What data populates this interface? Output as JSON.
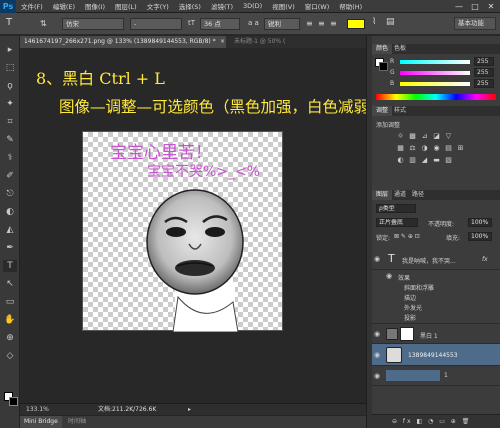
{
  "menu": {
    "logo": "Ps",
    "items": [
      "文件(F)",
      "编辑(E)",
      "图像(I)",
      "图层(L)",
      "文字(Y)",
      "选择(S)",
      "滤镜(T)",
      "3D(D)",
      "视图(V)",
      "窗口(W)",
      "帮助(H)"
    ],
    "window_controls": [
      "—",
      "□",
      "✕"
    ]
  },
  "options": {
    "tool_glyph": "T",
    "orient_glyph": "⇅",
    "font_family": "仿宋",
    "font_style": "-",
    "size_glyph": "tT",
    "font_size": "36 点",
    "aa_glyph": "a a",
    "anti_alias": "锐利",
    "align_icons": [
      "≡",
      "≡",
      "≡"
    ],
    "text_color": "#ffff00",
    "warp_glyph": "⌇",
    "panels_glyph": "▤",
    "workspace": "基本功能"
  },
  "document": {
    "tab1": "1461674197_266x271.png @ 133% (1389849144553, RGB/8) *",
    "tab1_close": "×",
    "tab2": "未标题-1 @ 50% (",
    "heading1": "8、黑白        Ctrl + L",
    "heading2": "图像—调整—可选颜色（黑色加强，白色减弱）",
    "meme_line1": "宝宝心里苦！",
    "meme_line2": "宝宝不哭%>_<%",
    "zoom": "133.1%",
    "doc_size": "文档:211.2K/726.6K",
    "status_arrow": "▸"
  },
  "minibridge": {
    "tab1": "Mini Bridge",
    "tab2": "时间轴"
  },
  "tools": [
    "▸",
    "⬚",
    "ϙ",
    "✦",
    "⌗",
    "✎",
    "⚕",
    "✐",
    "⎋",
    "◐",
    "◭",
    "✒",
    "T",
    "↖",
    "▭",
    "✋",
    "⊕",
    "◇"
  ],
  "panels": {
    "color_tabs": [
      "颜色",
      "色板"
    ],
    "color_values": [
      {
        "label": "R",
        "value": "255",
        "color": "#ff4d4d"
      },
      {
        "label": "G",
        "value": "255",
        "color": "#4dff4d"
      },
      {
        "label": "B",
        "value": "255",
        "color": "#4d7dff"
      }
    ],
    "adjust_tabs": [
      "调整",
      "样式"
    ],
    "adjust_title": "添加调整",
    "adjust_icons_row1": [
      "☼",
      "▩",
      "⊿",
      "◪",
      "▽"
    ],
    "adjust_icons_row2": [
      "▦",
      "⚖",
      "◑",
      "◉",
      "▤",
      "⊞"
    ],
    "adjust_icons_row3": [
      "◐",
      "▥",
      "◢",
      "▬",
      "▨"
    ],
    "layers_tabs": [
      "图层",
      "通道",
      "路径"
    ],
    "layer_filter": "ρ类型",
    "blend_mode": "正片叠底",
    "opacity_label": "不透明度:",
    "opacity_value": "100%",
    "lock_label": "锁定:",
    "lock_icons": "⊠ ✎ ⊕ ⊡",
    "fill_label": "填充:",
    "fill_value": "100%",
    "text_layer_glyph": "T",
    "text_layer": "我是呐喊，我不哭...",
    "fx_badge": "fx",
    "effects_label": "效果",
    "effects": [
      "斜面和浮雕",
      "描边",
      "外发光",
      "投影"
    ],
    "bw_layer": "黑白 1",
    "image_layer": "1389849144553",
    "bottom_layer": "1",
    "eye_glyph": "◉",
    "bottom_icons": "⊖ fx ◧ ◔ ▭ ⊕ 🗑"
  },
  "colors": {
    "heading": "#ffe93a",
    "meme_text": "#c855d0",
    "panel_bg": "#3c3c3c"
  }
}
